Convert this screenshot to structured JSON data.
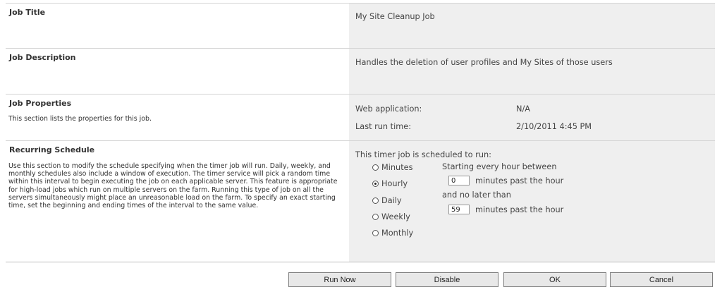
{
  "job_title": {
    "label": "Job Title",
    "value": "My Site Cleanup Job"
  },
  "job_description": {
    "label": "Job Description",
    "value": "Handles the deletion of user profiles and My Sites of those users"
  },
  "job_properties": {
    "label": "Job Properties",
    "description": "This section lists the properties for this job.",
    "web_app_label": "Web application:",
    "web_app_value": "N/A",
    "last_run_label": "Last run time:",
    "last_run_value": "2/10/2011 4:45 PM"
  },
  "recurring": {
    "label": "Recurring Schedule",
    "desc_lines": [
      "Use this section to modify the schedule specifying when the timer job will run. Daily, weekly, and",
      "monthly schedules also include a window of execution. The timer service will pick a random time",
      "within this interval to begin executing the job on each applicable server. This feature is appropriate",
      "for high-load jobs which run on multiple servers on the farm. Running this type of job on all the",
      "servers simultaneously might place an unreasonable load on the farm. To specify an exact starting",
      "time, set the beginning and ending times of the interval to the same value."
    ],
    "scheduled_text": "This timer job is scheduled to run:",
    "options": [
      "Minutes",
      "Hourly",
      "Daily",
      "Weekly",
      "Monthly"
    ],
    "selected": "Hourly",
    "starting_text": "Starting every hour between",
    "start_value": "0",
    "minutes_past_text_1": "minutes past the hour",
    "no_later_text": "and no later than",
    "end_value": "59",
    "minutes_past_text_2": "minutes past the hour"
  },
  "buttons": {
    "run_now": "Run Now",
    "disable": "Disable",
    "ok": "OK",
    "cancel": "Cancel"
  }
}
